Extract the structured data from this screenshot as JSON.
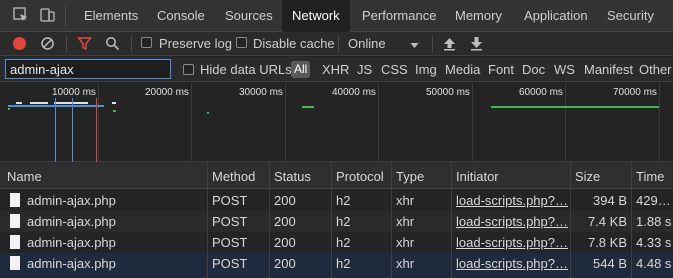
{
  "tabs": [
    {
      "label": "Elements",
      "active": false
    },
    {
      "label": "Console",
      "active": false
    },
    {
      "label": "Sources",
      "active": false
    },
    {
      "label": "Network",
      "active": true
    },
    {
      "label": "Performance",
      "active": false
    },
    {
      "label": "Memory",
      "active": false
    },
    {
      "label": "Application",
      "active": false
    },
    {
      "label": "Security",
      "active": false
    }
  ],
  "toolbar": {
    "preserve_log": "Preserve log",
    "disable_cache": "Disable cache",
    "throttling": "Online"
  },
  "filter": {
    "value": "admin-ajax",
    "hide_data_urls": "Hide data URLs",
    "types": [
      "All",
      "XHR",
      "JS",
      "CSS",
      "Img",
      "Media",
      "Font",
      "Doc",
      "WS",
      "Manifest",
      "Other"
    ]
  },
  "overview": {
    "ticks": [
      "10000 ms",
      "20000 ms",
      "30000 ms",
      "40000 ms",
      "50000 ms",
      "60000 ms",
      "70000 ms"
    ]
  },
  "table": {
    "headers": {
      "name": "Name",
      "method": "Method",
      "status": "Status",
      "protocol": "Protocol",
      "type": "Type",
      "initiator": "Initiator",
      "size": "Size",
      "time": "Time"
    },
    "rows": [
      {
        "name": "admin-ajax.php",
        "method": "POST",
        "status": "200",
        "protocol": "h2",
        "type": "xhr",
        "initiator": "load-scripts.php?…",
        "size": "394 B",
        "time": "429…"
      },
      {
        "name": "admin-ajax.php",
        "method": "POST",
        "status": "200",
        "protocol": "h2",
        "type": "xhr",
        "initiator": "load-scripts.php?…",
        "size": "7.4 KB",
        "time": "1.88 s"
      },
      {
        "name": "admin-ajax.php",
        "method": "POST",
        "status": "200",
        "protocol": "h2",
        "type": "xhr",
        "initiator": "load-scripts.php?…",
        "size": "7.8 KB",
        "time": "4.33 s"
      },
      {
        "name": "admin-ajax.php",
        "method": "POST",
        "status": "200",
        "protocol": "h2",
        "type": "xhr",
        "initiator": "load-scripts.php?…",
        "size": "544 B",
        "time": "4.48 s"
      }
    ]
  },
  "colors": {
    "accent_blue": "#4a90d9",
    "record_red": "#e2463b",
    "filter_red": "#e2463b",
    "timeline_green": "#3fb950",
    "timeline_red": "#e2463b"
  }
}
